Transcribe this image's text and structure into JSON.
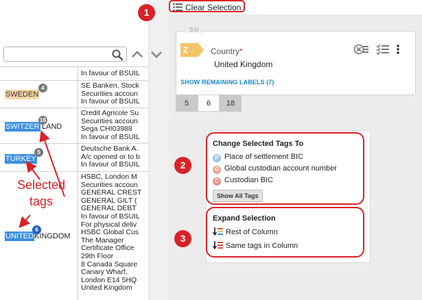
{
  "toolbar": {
    "clear_selection": "Clear Selection"
  },
  "markers": [
    "1",
    "2",
    "3"
  ],
  "annotation": {
    "selected_tags": "Selected\ntags"
  },
  "grid": {
    "top_row_lines": [
      "In favour of BSUIL"
    ],
    "rows": [
      {
        "tag": "SWEDEN",
        "tag_rest": "",
        "badge": "4",
        "selected": false,
        "lines": [
          "SE Banken, Stock",
          "Securities accoun",
          "In favour of BSUIL"
        ]
      },
      {
        "tag": "SWITZER",
        "tag_rest": "LAND",
        "badge": "18",
        "selected": true,
        "lines": [
          "Credit Agricole Su",
          "Securities accoun",
          "Sega CHI03988",
          "In favour of BSUIL"
        ]
      },
      {
        "tag": "TURKEY",
        "tag_rest": "",
        "badge": "5",
        "selected": true,
        "lines": [
          "Deutsche Bank A.",
          "A/c opened or to b",
          "In favour of BSUIL"
        ]
      },
      {
        "tag": "UNITED",
        "tag_rest": " KINGDOM",
        "badge": "6",
        "selected": true,
        "lines": [
          "HSBC, London M",
          "Securities accoun",
          "GENERAL CREST",
          "GENERAL GILT (",
          "GENERAL DEBT",
          "In favour of BSUIL",
          "For physical deliv",
          "HSBC Global Cus",
          "The Manager",
          "Certificate Office",
          "29th Floor",
          "8 Canada Square",
          "Canary Wharf,",
          "London E14 5HQ",
          "United Kingdom"
        ]
      }
    ]
  },
  "ssi": {
    "title": "SSI",
    "badge_letter": "Z",
    "field_label": "Country",
    "required_mark": "*",
    "field_value": "United Kingdom",
    "show_remaining": "SHOW REMAINING LABELS (7)",
    "tabs": [
      "5",
      "6",
      "18"
    ]
  },
  "change_tags": {
    "title": "Change Selected Tags To",
    "options": [
      {
        "letter": "P",
        "label": "Place of settlement BIC",
        "color": "#9fc6ea"
      },
      {
        "letter": "G",
        "label": "Global custodian account number",
        "color": "#f1a48f"
      },
      {
        "letter": "C",
        "label": "Custodian BIC",
        "color": "#e9958a"
      }
    ],
    "show_all": "Show All Tags"
  },
  "expand_selection": {
    "title": "Expand Selection",
    "options": [
      "Rest of Column",
      "Same tags in Column"
    ]
  },
  "colors": {
    "accent_red": "#d92127",
    "selection_blue": "#3b8fe0",
    "link_blue": "#1a87c9"
  }
}
